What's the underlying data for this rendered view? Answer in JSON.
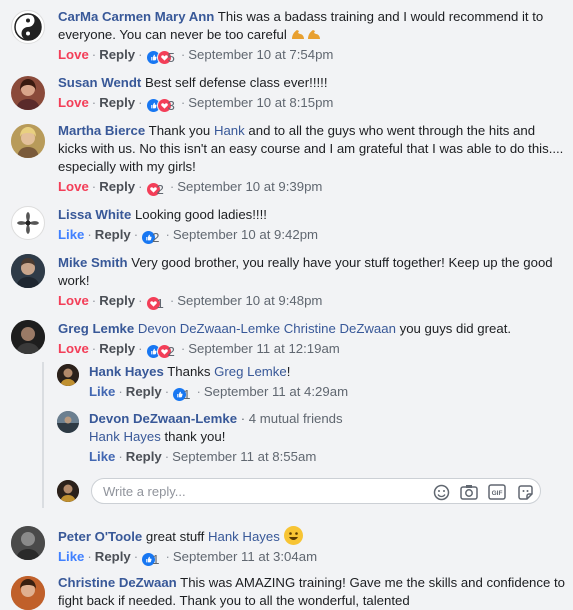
{
  "comments": [
    {
      "name": "CarMa Carmen Mary Ann",
      "text": "This was a badass training and I would recommend it to everyone. You can never be too careful",
      "reaction_label": "Love",
      "reply_label": "Reply",
      "count": "5",
      "time": "September 10 at 7:54pm"
    },
    {
      "name": "Susan Wendt",
      "text": "Best self defense class ever!!!!!",
      "reaction_label": "Love",
      "reply_label": "Reply",
      "count": "3",
      "time": "September 10 at 8:15pm"
    },
    {
      "name": "Martha Bierce",
      "text_before": "Thank you",
      "mention": "Hank",
      "text_after": "and to all the guys who went through the hits and kicks with us. No this isn't an easy course and I am grateful that I was able to do this.... especially with my girls!",
      "reaction_label": "Love",
      "reply_label": "Reply",
      "count": "2",
      "time": "September 10 at 9:39pm"
    },
    {
      "name": "Lissa White",
      "text": "Looking good ladies!!!!",
      "reaction_label": "Like",
      "reply_label": "Reply",
      "count": "2",
      "time": "September 10 at 9:42pm"
    },
    {
      "name": "Mike Smith",
      "text": "Very good brother, you really have your stuff together! Keep up the good work!",
      "reaction_label": "Love",
      "reply_label": "Reply",
      "count": "1",
      "time": "September 10 at 9:48pm"
    },
    {
      "name": "Greg Lemke",
      "mention1": "Devon DeZwaan-Lemke",
      "mention2": "Christine DeZwaan",
      "text_after": "you guys did great.",
      "reaction_label": "Love",
      "reply_label": "Reply",
      "count": "2",
      "time": "September 11 at 12:19am"
    },
    {
      "name": "Peter O'Toole",
      "text": "great stuff",
      "mention": "Hank Hayes",
      "reaction_label": "Like",
      "reply_label": "Reply",
      "count": "1",
      "time": "September 11 at 3:04am"
    },
    {
      "name": "Christine DeZwaan",
      "text": "This was AMAZING training! Gave me the skills and confidence to fight back if needed. Thank you to all the wonderful, talented"
    }
  ],
  "replies": [
    {
      "name": "Hank Hayes",
      "text": "Thanks",
      "mention": "Greg Lemke",
      "text_after": "!",
      "like_label": "Like",
      "reply_label": "Reply",
      "count": "1",
      "time": "September 11 at 4:29am"
    },
    {
      "name": "Devon DeZwaan-Lemke",
      "meta": "· 4 mutual friends",
      "mention": "Hank Hayes",
      "text_after": "thank you!",
      "like_label": "Like",
      "reply_label": "Reply",
      "time": "September 11 at 8:55am"
    }
  ],
  "reply_box": {
    "placeholder": "Write a reply..."
  },
  "separator": "·",
  "icons": {
    "reaction_like": "like-reaction-icon",
    "reaction_love": "love-reaction-icon",
    "emoji": "smiley-icon",
    "camera": "camera-icon",
    "gif": "gif-icon",
    "sticker": "sticker-icon"
  },
  "colors": {
    "name": "#385898",
    "love": "#f33e58",
    "like": "#4080ff",
    "background": "#f2f3f5"
  }
}
